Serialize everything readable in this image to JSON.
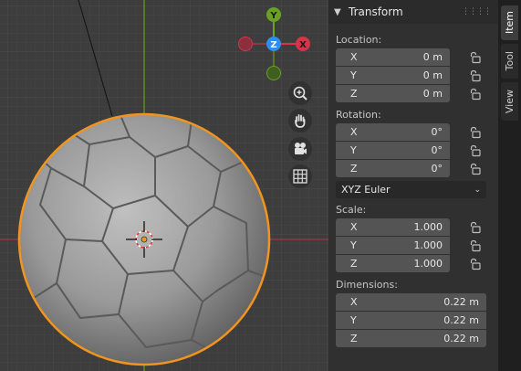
{
  "panel": {
    "header_title": "Transform",
    "location": {
      "label": "Location:",
      "fields": [
        {
          "axis": "X",
          "value": "0 m"
        },
        {
          "axis": "Y",
          "value": "0 m"
        },
        {
          "axis": "Z",
          "value": "0 m"
        }
      ]
    },
    "rotation": {
      "label": "Rotation:",
      "fields": [
        {
          "axis": "X",
          "value": "0°"
        },
        {
          "axis": "Y",
          "value": "0°"
        },
        {
          "axis": "Z",
          "value": "0°"
        }
      ],
      "mode": "XYZ Euler"
    },
    "scale": {
      "label": "Scale:",
      "fields": [
        {
          "axis": "X",
          "value": "1.000"
        },
        {
          "axis": "Y",
          "value": "1.000"
        },
        {
          "axis": "Z",
          "value": "1.000"
        }
      ]
    },
    "dimensions": {
      "label": "Dimensions:",
      "fields": [
        {
          "axis": "X",
          "value": "0.22 m"
        },
        {
          "axis": "Y",
          "value": "0.22 m"
        },
        {
          "axis": "Z",
          "value": "0.22 m"
        }
      ]
    }
  },
  "tabs": [
    {
      "label": "Item",
      "active": true
    },
    {
      "label": "Tool",
      "active": false
    },
    {
      "label": "View",
      "active": false
    }
  ],
  "gizmo": {
    "y_label": "Y",
    "z_label": "Z",
    "x_label": "X"
  },
  "viewport_tools": [
    "zoom-icon",
    "hand-pan-icon",
    "camera-icon",
    "grid-icon"
  ],
  "colors": {
    "x_axis": "#d6344a",
    "y_axis": "#6aa123",
    "z_axis": "#2e8ef0",
    "selection_outline": "#f1951f",
    "panel_bg": "#303030",
    "field_bg": "#545454"
  }
}
